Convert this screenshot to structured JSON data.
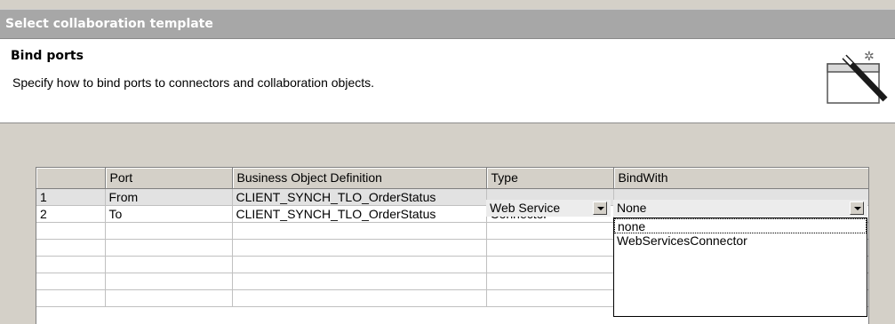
{
  "window": {
    "title": "Select collaboration template"
  },
  "header": {
    "title": "Bind ports",
    "description": "Specify how to bind ports to connectors and collaboration objects.",
    "icon": "wizard-wand-icon"
  },
  "table": {
    "columns": [
      "",
      "Port",
      "Business Object Definition",
      "Type",
      "BindWith"
    ],
    "rows": [
      {
        "num": "1",
        "port": "From",
        "bo": "CLIENT_SYNCH_TLO_OrderStatus",
        "type": "Web Service",
        "bind": "None"
      },
      {
        "num": "2",
        "port": "To",
        "bo": "CLIENT_SYNCH_TLO_OrderStatus",
        "type": "Connector",
        "bind": ""
      }
    ]
  },
  "dropdown": {
    "options": [
      "none",
      "WebServicesConnector"
    ]
  }
}
